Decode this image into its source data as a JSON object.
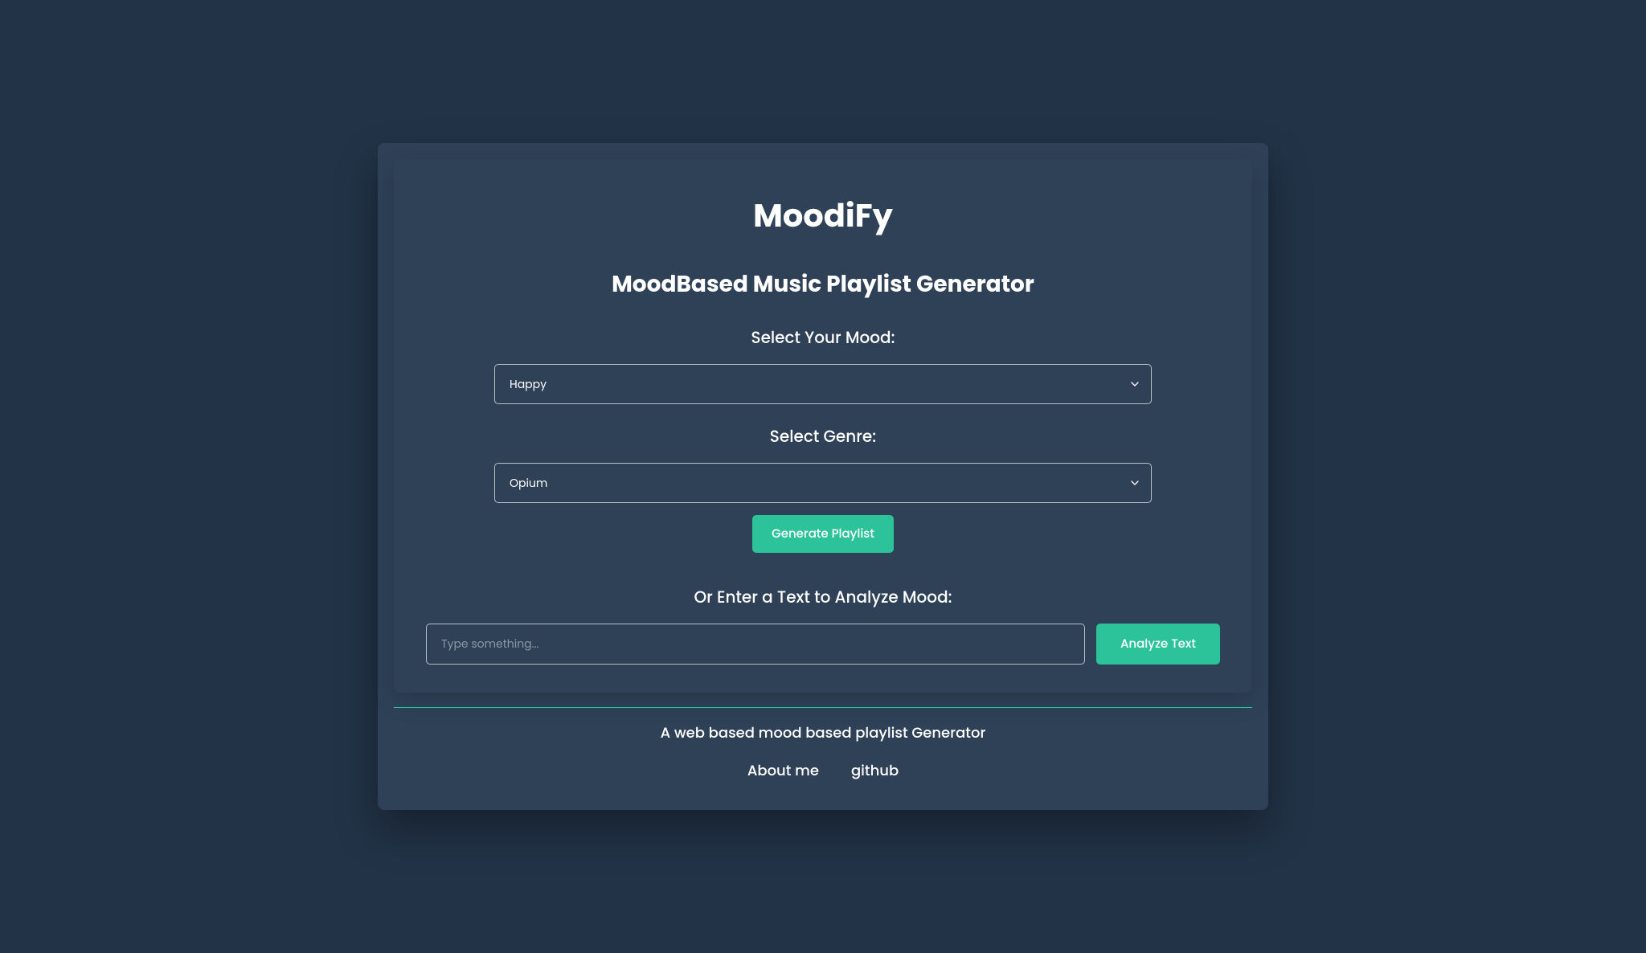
{
  "header": {
    "title": "MoodiFy",
    "subtitle": "MoodBased Music Playlist Generator"
  },
  "mood": {
    "label": "Select Your Mood:",
    "selected": "Happy"
  },
  "genre": {
    "label": "Select Genre:",
    "selected": "Opium"
  },
  "buttons": {
    "generate": "Generate Playlist",
    "analyze": "Analyze Text"
  },
  "analyze": {
    "label": "Or Enter a Text to Analyze Mood:",
    "placeholder": "Type something..."
  },
  "footer": {
    "text": "A web based mood based playlist Generator",
    "links": {
      "about": "About me",
      "github": "github"
    }
  }
}
